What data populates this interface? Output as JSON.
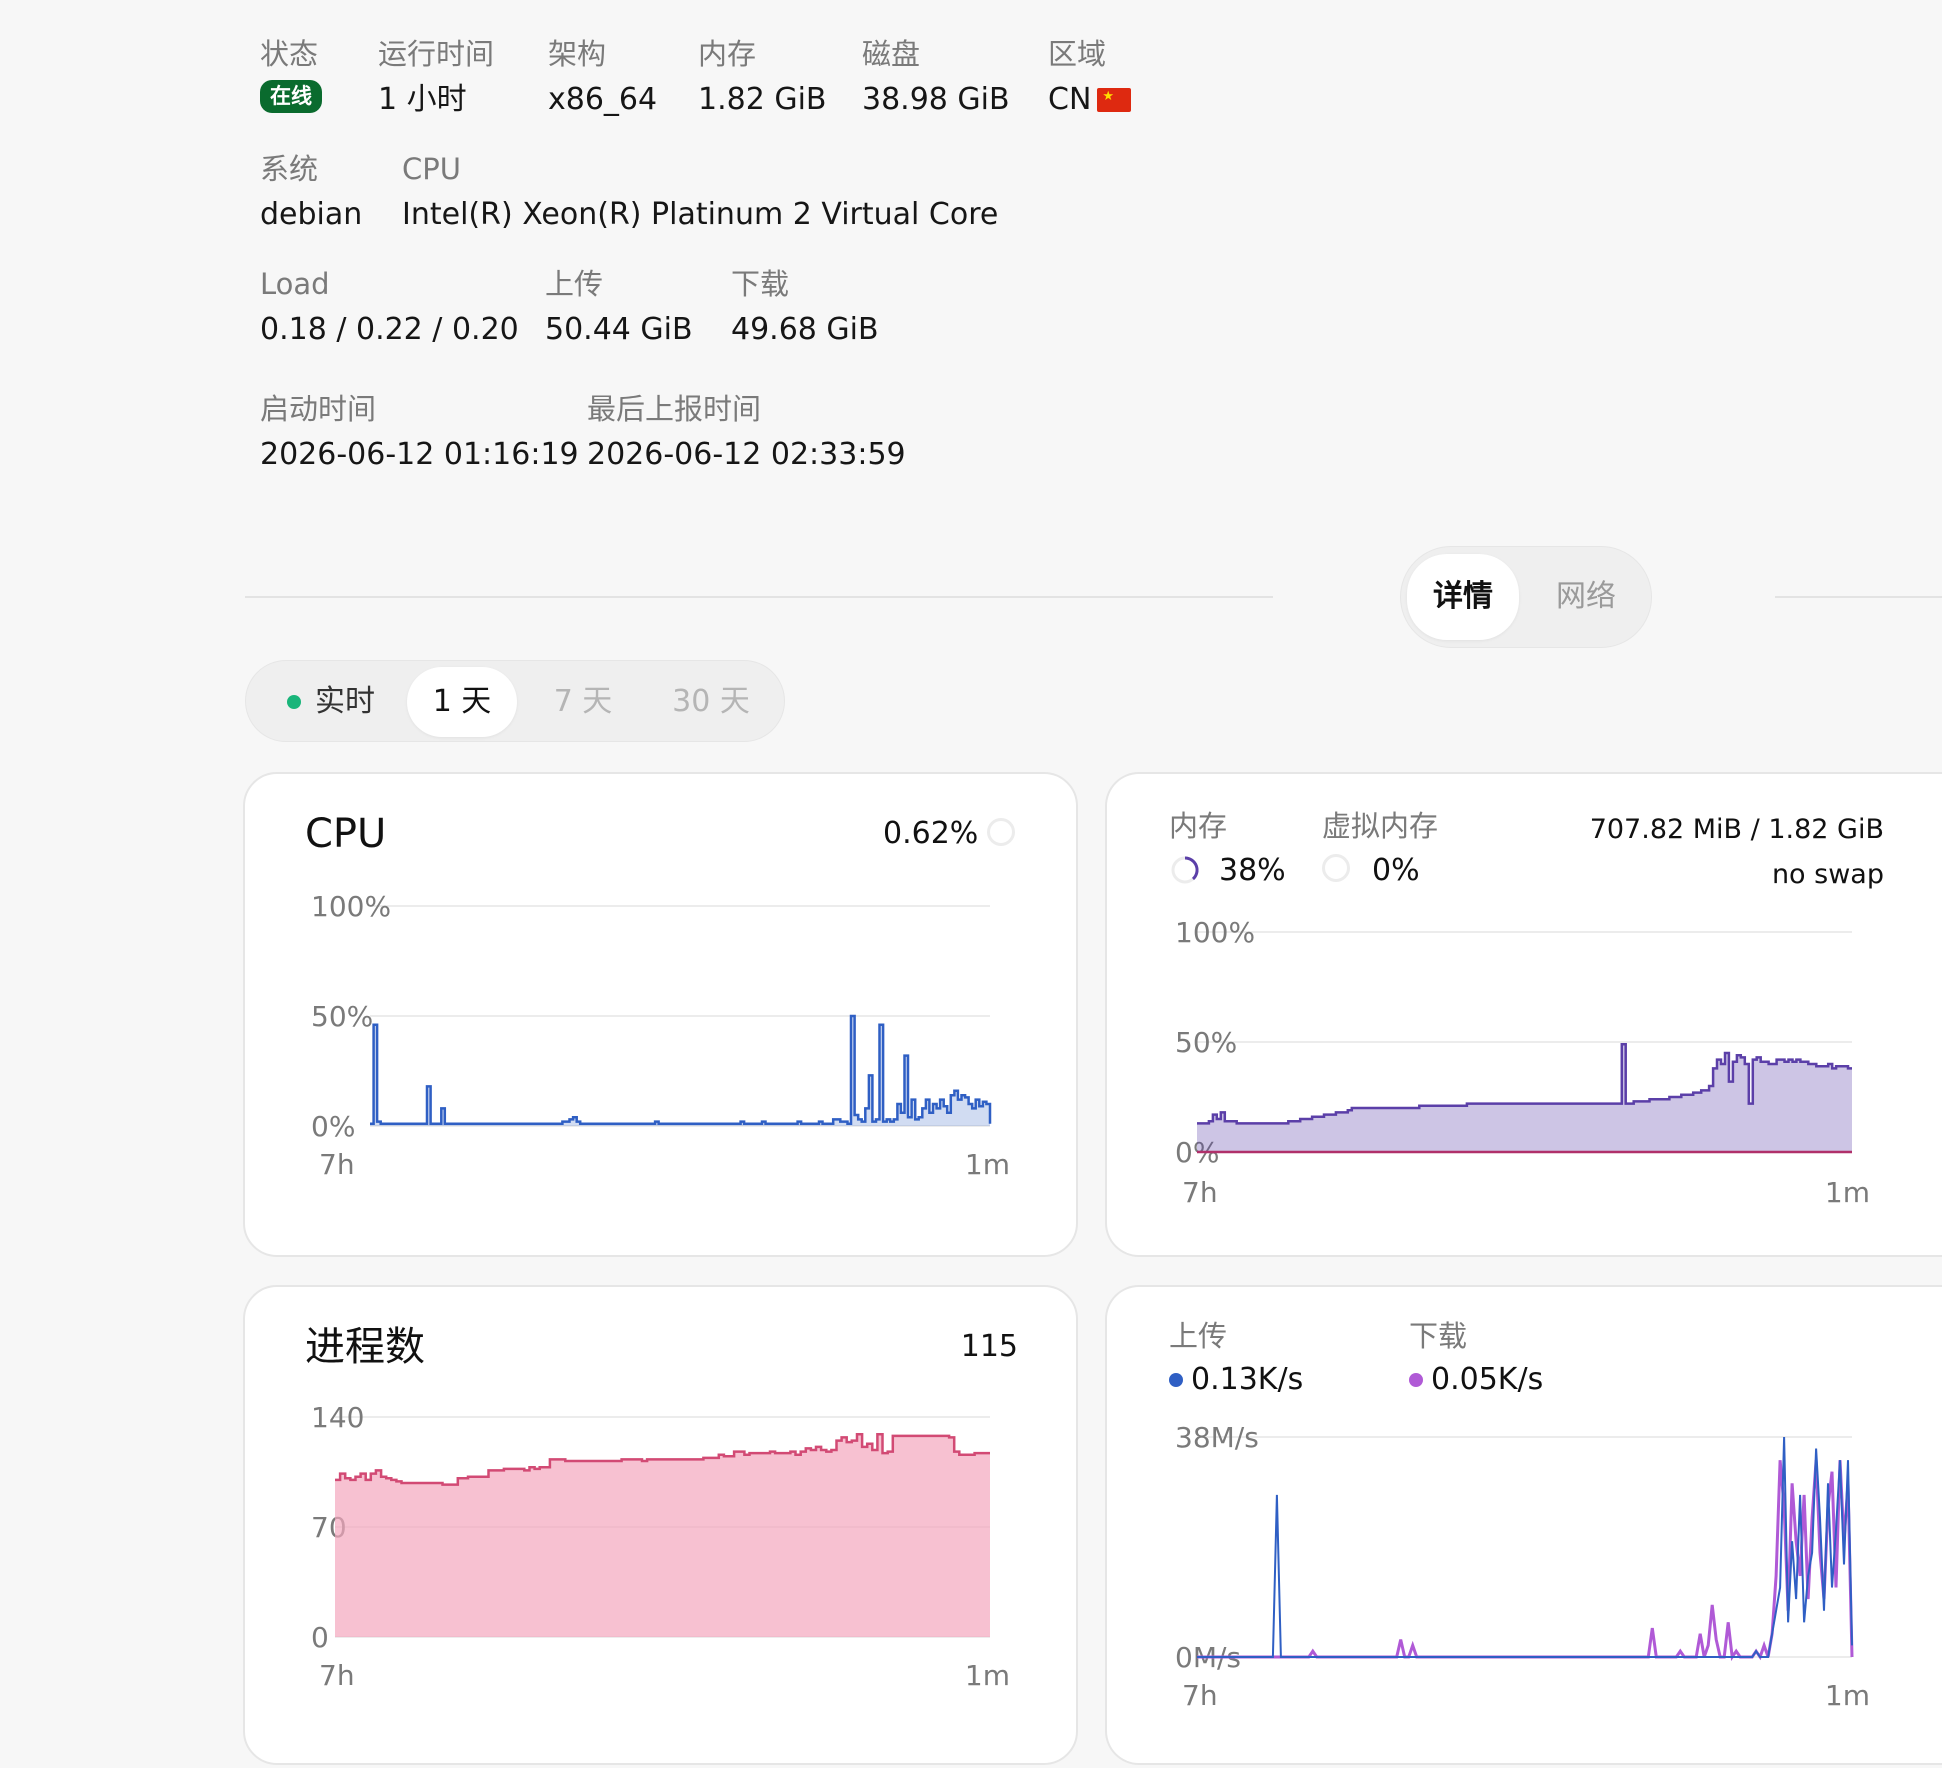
{
  "info": {
    "status_label": "状态",
    "status_value": "在线",
    "uptime_label": "运行时间",
    "uptime_value": "1 小时",
    "arch_label": "架构",
    "arch_value": "x86_64",
    "mem_label": "内存",
    "mem_value": "1.82 GiB",
    "disk_label": "磁盘",
    "disk_value": "38.98 GiB",
    "region_label": "区域",
    "region_value": "CN",
    "system_label": "系统",
    "system_value": "debian",
    "cpu_label": "CPU",
    "cpu_value": "Intel(R) Xeon(R) Platinum 2 Virtual Core",
    "load_label": "Load",
    "load_value": "0.18 / 0.22 / 0.20",
    "upload_label": "上传",
    "upload_value": "50.44 GiB",
    "download_label": "下载",
    "download_value": "49.68 GiB",
    "boot_label": "启动时间",
    "boot_value": "2026-06-12 01:16:19",
    "report_label": "最后上报时间",
    "report_value": "2026-06-12 02:33:59"
  },
  "view_tabs": {
    "detail": "详情",
    "network": "网络"
  },
  "range_tabs": {
    "realtime": "实时",
    "day": "1 天",
    "week": "7 天",
    "month": "30 天"
  },
  "colors": {
    "cpu": "#2f5fc4",
    "mem": "#5b3fa8",
    "proc": "#d24a74",
    "up": "#2f5fc4",
    "down": "#b05ad6",
    "online": "#0a6b2e",
    "live_dot": "#19b57a"
  },
  "cpu_card": {
    "title": "CPU",
    "value": "0.62%",
    "y_ticks": [
      "100%",
      "50%",
      "0%"
    ],
    "x_start": "7h",
    "x_end": "1m"
  },
  "mem_card": {
    "mem_label": "内存",
    "mem_pct": "38%",
    "swap_label": "虚拟内存",
    "swap_pct": "0%",
    "usage": "707.82 MiB / 1.82 GiB",
    "swap_note": "no swap",
    "y_ticks": [
      "100%",
      "50%",
      "0%"
    ],
    "x_start": "7h",
    "x_end": "1m"
  },
  "proc_card": {
    "title": "进程数",
    "value": "115",
    "y_ticks": [
      "140",
      "70",
      "0"
    ],
    "x_start": "7h",
    "x_end": "1m"
  },
  "net_card": {
    "up_label": "上传",
    "up_value": "0.13K/s",
    "down_label": "下载",
    "down_value": "0.05K/s",
    "y_ticks": [
      "38M/s",
      "0M/s"
    ],
    "x_start": "7h",
    "x_end": "1m"
  },
  "chart_data": [
    {
      "type": "area",
      "title": "CPU",
      "ylim": [
        0,
        100
      ],
      "x_labels": [
        "7h",
        "1m"
      ],
      "series": [
        {
          "values": [
            1,
            46,
            2,
            1,
            1,
            1,
            1,
            1,
            1,
            1,
            1,
            1,
            1,
            1,
            1,
            1,
            18,
            1,
            1,
            1,
            8,
            1,
            1,
            1,
            1,
            1,
            1,
            1,
            1,
            1,
            1,
            1,
            1,
            1,
            1,
            1,
            1,
            1,
            1,
            1,
            1,
            1,
            1,
            1,
            1,
            1,
            1,
            1,
            1,
            1,
            1,
            1,
            1,
            1,
            2,
            2,
            3,
            4,
            2,
            1,
            1,
            1,
            1,
            1,
            1,
            1,
            1,
            1,
            1,
            1,
            1,
            1,
            1,
            1,
            1,
            1,
            1,
            1,
            1,
            1,
            2,
            1,
            1,
            1,
            1,
            1,
            1,
            1,
            1,
            1,
            1,
            1,
            1,
            1,
            1,
            1,
            1,
            1,
            1,
            1,
            1,
            1,
            1,
            1,
            2,
            1,
            1,
            1,
            1,
            1,
            2,
            1,
            1,
            1,
            1,
            1,
            1,
            1,
            1,
            1,
            2,
            1,
            1,
            1,
            1,
            1,
            2,
            1,
            1,
            1,
            3,
            3,
            2,
            2,
            1,
            50,
            5,
            3,
            2,
            8,
            23,
            2,
            3,
            46,
            2,
            3,
            2,
            3,
            10,
            6,
            32,
            4,
            12,
            3,
            4,
            8,
            12,
            6,
            10,
            8,
            12,
            9,
            6,
            14,
            16,
            12,
            14,
            13,
            10,
            8,
            12,
            9,
            11,
            10,
            1
          ]
        }
      ]
    },
    {
      "type": "area",
      "title": "内存",
      "ylim": [
        0,
        100
      ],
      "x_labels": [
        "7h",
        "1m"
      ],
      "series": [
        {
          "name": "内存",
          "values": [
            13,
            13,
            13,
            14,
            17,
            15,
            18,
            14,
            14,
            14,
            13,
            13,
            13,
            13,
            13,
            13,
            13,
            13,
            13,
            13,
            13,
            13,
            13,
            14,
            14,
            14,
            15,
            15,
            15,
            16,
            16,
            16,
            17,
            17,
            17,
            18,
            18,
            18,
            19,
            20,
            20,
            20,
            20,
            20,
            20,
            20,
            20,
            20,
            20,
            20,
            20,
            20,
            20,
            20,
            20,
            20,
            21,
            21,
            21,
            21,
            21,
            21,
            21,
            21,
            21,
            21,
            21,
            21,
            22,
            22,
            22,
            22,
            22,
            22,
            22,
            22,
            22,
            22,
            22,
            22,
            22,
            22,
            22,
            22,
            22,
            22,
            22,
            22,
            22,
            22,
            22,
            22,
            22,
            22,
            22,
            22,
            22,
            22,
            22,
            22,
            22,
            22,
            22,
            22,
            22,
            22,
            22,
            49,
            22,
            22,
            23,
            23,
            23,
            23,
            24,
            24,
            24,
            24,
            24,
            25,
            25,
            25,
            26,
            26,
            26,
            27,
            27,
            28,
            28,
            30,
            38,
            42,
            40,
            45,
            32,
            41,
            44,
            43,
            40,
            22,
            42,
            43,
            41,
            41,
            40,
            40,
            42,
            42,
            41,
            42,
            41,
            42,
            41,
            41,
            40,
            40,
            39,
            39,
            39,
            40,
            38,
            39,
            39,
            39,
            38,
            38
          ]
        },
        {
          "name": "虚拟内存",
          "values": [
            0,
            0,
            0,
            0,
            0,
            0,
            0,
            0,
            0,
            0
          ]
        }
      ]
    },
    {
      "type": "area",
      "title": "进程数",
      "ylim": [
        0,
        140
      ],
      "x_labels": [
        "7h",
        "1m"
      ],
      "series": [
        {
          "values": [
            100,
            104,
            101,
            100,
            102,
            104,
            100,
            104,
            106,
            102,
            101,
            100,
            99,
            98,
            98,
            98,
            98,
            98,
            98,
            98,
            98,
            97,
            97,
            97,
            101,
            101,
            102,
            102,
            102,
            102,
            106,
            106,
            106,
            107,
            107,
            107,
            107,
            106,
            108,
            107,
            108,
            108,
            113,
            113,
            113,
            112,
            112,
            112,
            112,
            112,
            112,
            112,
            112,
            112,
            112,
            112,
            113,
            113,
            113,
            113,
            112,
            113,
            113,
            113,
            113,
            113,
            113,
            113,
            113,
            113,
            113,
            113,
            114,
            114,
            114,
            116,
            115,
            115,
            118,
            118,
            116,
            117,
            117,
            117,
            117,
            118,
            117,
            117,
            117,
            118,
            116,
            118,
            120,
            119,
            121,
            119,
            118,
            119,
            125,
            127,
            124,
            125,
            129,
            121,
            123,
            119,
            129,
            117,
            118,
            128,
            128,
            128,
            128,
            128,
            128,
            128,
            128,
            128,
            128,
            128,
            127,
            118,
            116,
            116,
            116,
            117,
            117,
            117,
            117
          ]
        }
      ]
    },
    {
      "type": "line",
      "title": "网络",
      "ylim": [
        0,
        38
      ],
      "x_labels": [
        "7h",
        "1m"
      ],
      "series": [
        {
          "name": "上传",
          "values": [
            0,
            0,
            0,
            0,
            0,
            0,
            0,
            0,
            0,
            0,
            0,
            0,
            0,
            0,
            0,
            0,
            0,
            0,
            0,
            0,
            28,
            0,
            0,
            0,
            0,
            0,
            0,
            0,
            0,
            0,
            0,
            0,
            0,
            0,
            0,
            0,
            0,
            0,
            0,
            0,
            0,
            0,
            0,
            0,
            0,
            0,
            0,
            0,
            0,
            0,
            0,
            0,
            0,
            0,
            0,
            0,
            0,
            0,
            0,
            0,
            0,
            0,
            0,
            0,
            0,
            0,
            0,
            0,
            0,
            0,
            0,
            0,
            0,
            0,
            0,
            0,
            0,
            0,
            0,
            0,
            0,
            0,
            0,
            0,
            0,
            0,
            0,
            0,
            0,
            0,
            0,
            0,
            0,
            0,
            0,
            0,
            0,
            0,
            0,
            0,
            0,
            0,
            0,
            0,
            0,
            0,
            0,
            0,
            0,
            0,
            0,
            0,
            0,
            0,
            0,
            0,
            0,
            0,
            0,
            0,
            0,
            0,
            0,
            0,
            0,
            0,
            0,
            0,
            0,
            0,
            0,
            0,
            0,
            0,
            0,
            0,
            0,
            0,
            0,
            0,
            1,
            0,
            0,
            0,
            4,
            8,
            12,
            38,
            6,
            20,
            10,
            28,
            6,
            14,
            18,
            36,
            24,
            8,
            30,
            12,
            22,
            34,
            16,
            34,
            2
          ]
        },
        {
          "name": "下载",
          "values": [
            0,
            0,
            0,
            0,
            0,
            0,
            0,
            0,
            0,
            0,
            0,
            0,
            0,
            0,
            0,
            0,
            0,
            0,
            0,
            0,
            0,
            0,
            0,
            0,
            0,
            0,
            0,
            0,
            0,
            1,
            0,
            0,
            0,
            0,
            0,
            0,
            0,
            0,
            0,
            0,
            0,
            0,
            0,
            0,
            0,
            0,
            0,
            0,
            0,
            0,
            0,
            3,
            0,
            0,
            2,
            0,
            0,
            0,
            0,
            0,
            0,
            0,
            0,
            0,
            0,
            0,
            0,
            0,
            0,
            0,
            0,
            0,
            0,
            0,
            0,
            0,
            0,
            0,
            0,
            0,
            0,
            0,
            0,
            0,
            0,
            0,
            0,
            0,
            0,
            0,
            0,
            0,
            0,
            0,
            0,
            0,
            0,
            0,
            0,
            0,
            0,
            0,
            0,
            0,
            0,
            0,
            0,
            0,
            0,
            0,
            0,
            0,
            0,
            0,
            5,
            0,
            0,
            0,
            0,
            0,
            0,
            1,
            0,
            0,
            0,
            0,
            4,
            0,
            2,
            9,
            3,
            0,
            0,
            6,
            0,
            1,
            0,
            0,
            0,
            0,
            1,
            0,
            2,
            0,
            4,
            14,
            34,
            26,
            8,
            30,
            20,
            14,
            28,
            10,
            24,
            34,
            18,
            10,
            26,
            32,
            12,
            34,
            20,
            30,
            0
          ]
        }
      ]
    }
  ]
}
